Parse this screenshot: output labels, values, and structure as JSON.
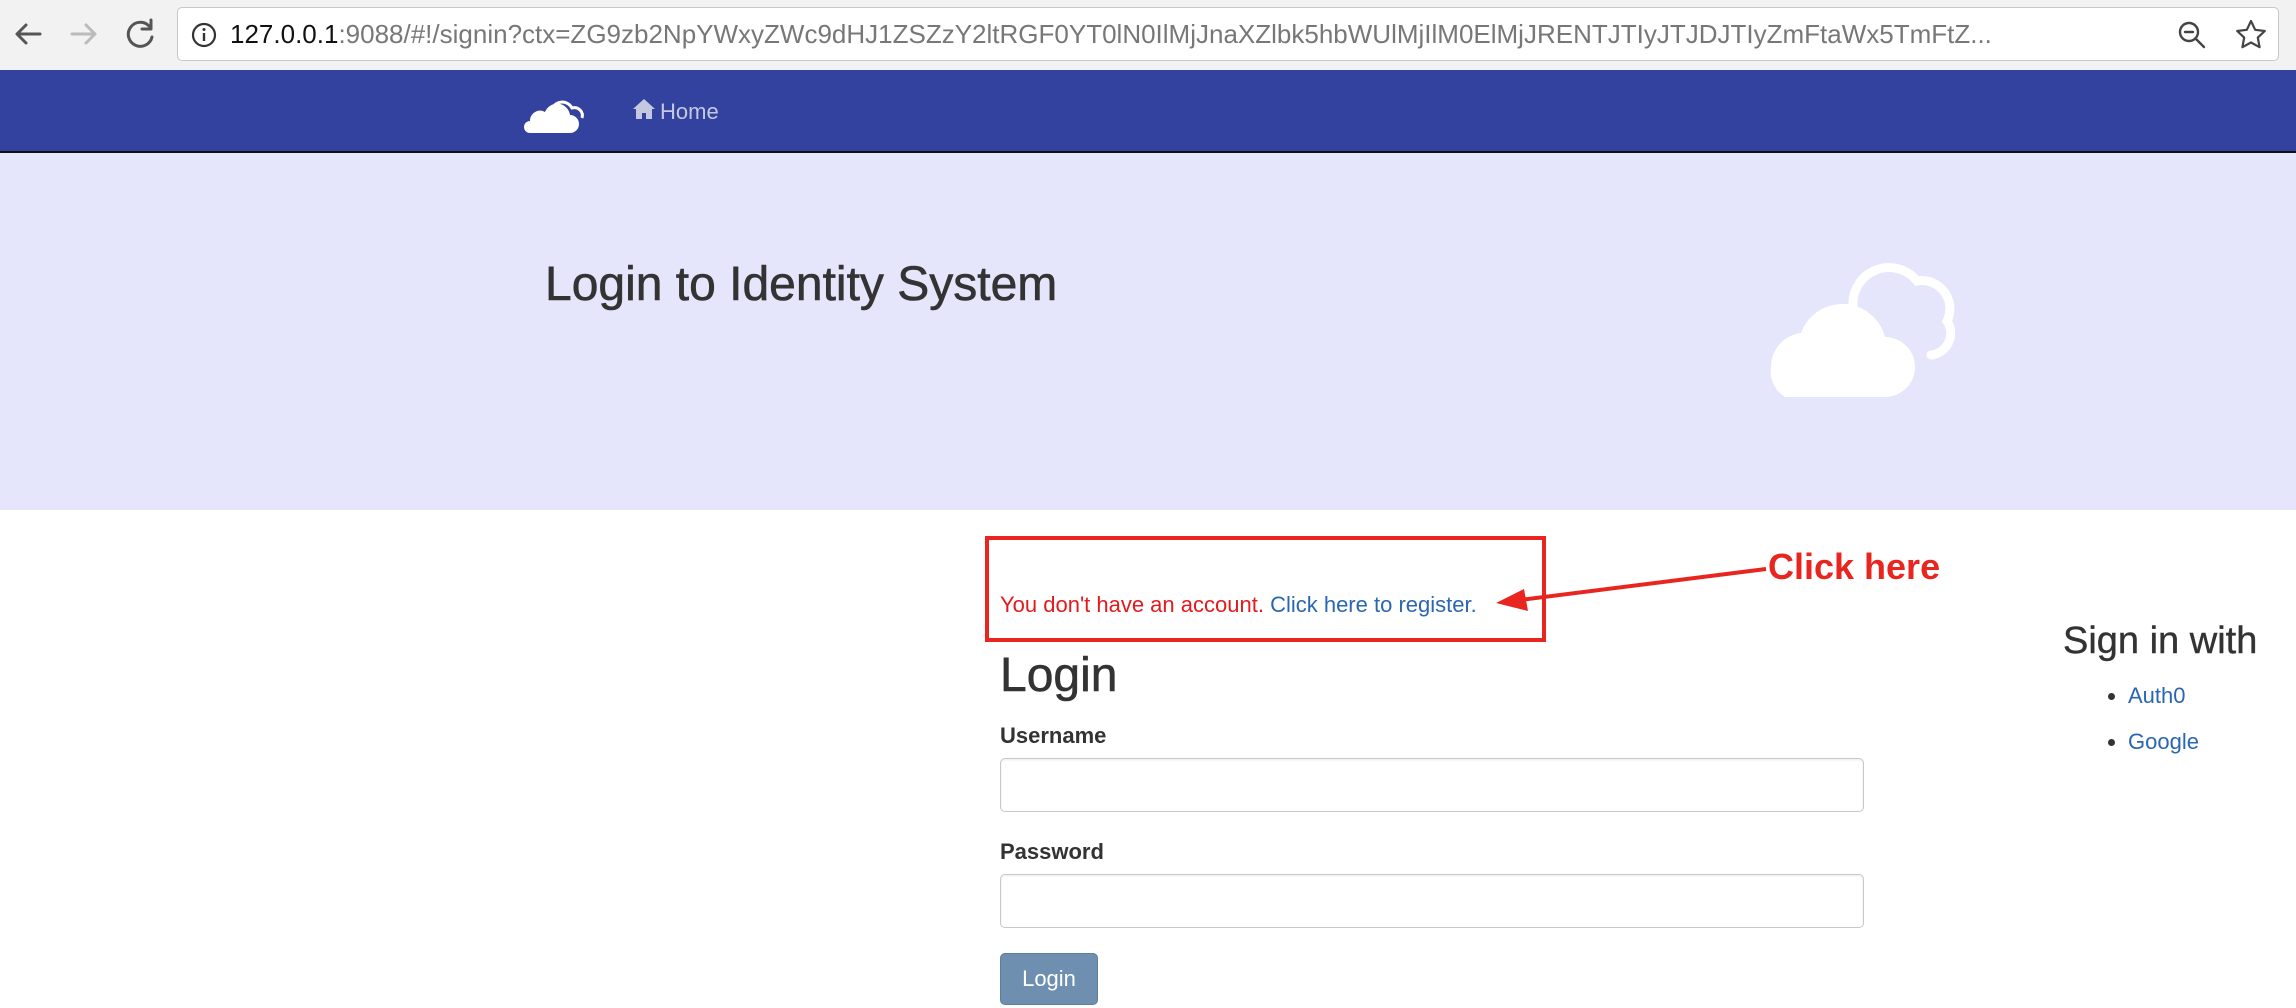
{
  "browser": {
    "url_host": "127.0.0.1",
    "url_rest": ":9088/#!/signin?ctx=ZG9zb2NpYWxyZWc9dHJ1ZSZzY2ltRGF0YT0lN0IlMjJnaXZlbk5hbWUlMjIlM0ElMjJRENTJTIyJTJDJTIyZmFtaWx5TmFtZ..."
  },
  "nav": {
    "home_label": "Home"
  },
  "jumbotron": {
    "title": "Login to Identity System"
  },
  "alert": {
    "message": "You don't have an account.",
    "link_text": "Click here to register."
  },
  "annotation": {
    "label": "Click here",
    "color": "#e8251f"
  },
  "login": {
    "heading": "Login",
    "username_label": "Username",
    "username_value": "",
    "password_label": "Password",
    "password_value": "",
    "button_label": "Login"
  },
  "external": {
    "heading": "Sign in with",
    "providers": [
      {
        "label": "Auth0"
      },
      {
        "label": "Google"
      }
    ]
  },
  "colors": {
    "navbar": "#33429e",
    "jumbotron": "#e5e5fb",
    "link": "#2a67b0",
    "alert_text": "#e41a1c",
    "login_button": "#6f8fb0"
  }
}
